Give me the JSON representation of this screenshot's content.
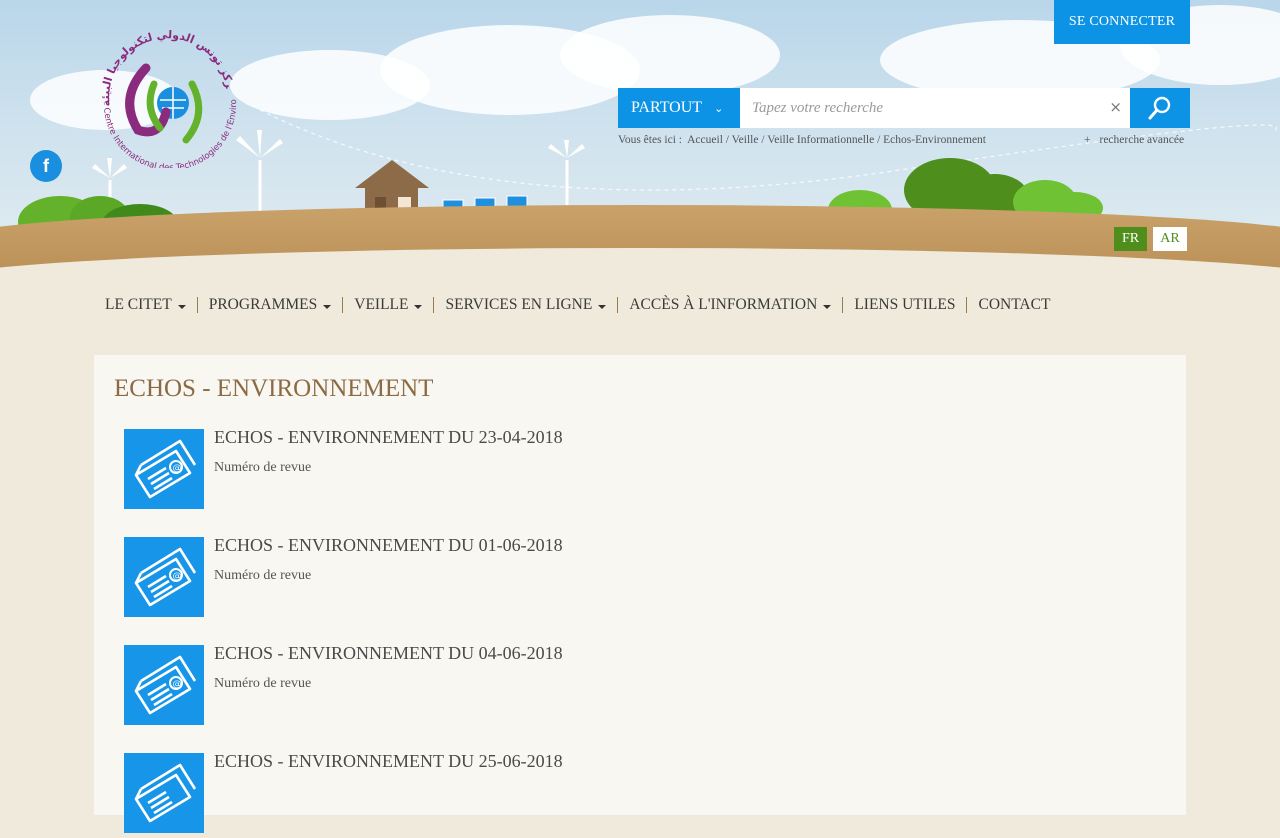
{
  "header": {
    "login_label": "SE CONNECTER",
    "logo_text_ar": "مركز تونس الدولي لتكنولوجيا البيئة",
    "logo_text_fr": "Centre International des Technologies de l'Environnement de Tunis",
    "social": {
      "facebook_label": "f"
    }
  },
  "search": {
    "scope_label": "PARTOUT",
    "placeholder": "Tapez votre recherche",
    "clear_label": "×",
    "advanced_label": "recherche avancée",
    "advanced_prefix": "+"
  },
  "breadcrumb": {
    "prefix": "Vous êtes ici :",
    "items": [
      "Accueil",
      "Veille",
      "Veille Informationnelle",
      "Echos-Environnement"
    ],
    "separator": "/"
  },
  "languages": {
    "fr": "FR",
    "ar": "AR",
    "active": "FR"
  },
  "nav": {
    "items": [
      {
        "label": "LE CITET"
      },
      {
        "label": "PROGRAMMES"
      },
      {
        "label": "VEILLE"
      },
      {
        "label": "SERVICES EN LIGNE"
      },
      {
        "label": "ACCÈS À L'INFORMATION"
      },
      {
        "label": "LIENS UTILES"
      },
      {
        "label": "CONTACT"
      }
    ]
  },
  "main": {
    "title": "ECHOS - ENVIRONNEMENT",
    "entries": [
      {
        "title": "ECHOS - ENVIRONNEMENT DU 23-04-2018",
        "subtitle": "Numéro de revue"
      },
      {
        "title": "ECHOS - ENVIRONNEMENT DU 01-06-2018",
        "subtitle": "Numéro de revue"
      },
      {
        "title": "ECHOS - ENVIRONNEMENT DU 04-06-2018",
        "subtitle": "Numéro de revue"
      },
      {
        "title": "ECHOS - ENVIRONNEMENT DU 25-06-2018",
        "subtitle": ""
      }
    ]
  },
  "colors": {
    "primary_blue": "#0d93e6",
    "title_brown": "#8b6a44",
    "lang_green": "#4f8e1a",
    "page_bg": "#efeadb"
  }
}
